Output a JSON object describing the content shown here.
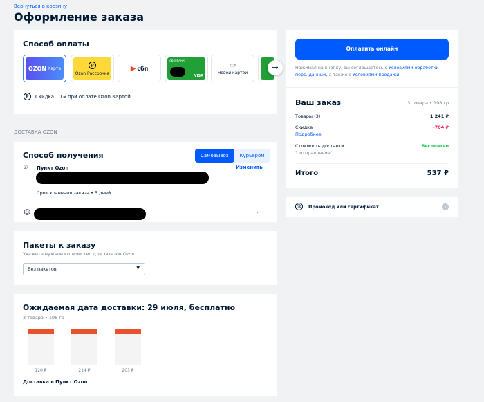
{
  "header": {
    "back_link": "Вернуться в корзину",
    "title": "Оформление заказа"
  },
  "payment": {
    "title": "Способ оплаты",
    "methods": [
      {
        "label": "OZON",
        "sub": "Карта"
      },
      {
        "label": "Ozon Рассрочка"
      },
      {
        "label": "сбп"
      },
      {
        "label": "СБЕРБАНК",
        "sub": "VISA"
      },
      {
        "label": "Новой картой"
      }
    ],
    "discount_note": "Скидка 10 ₽ при оплате Ozon Картой"
  },
  "delivery_section_label": "ДОСТАВКА OZON",
  "receipt": {
    "title": "Способ получения",
    "tabs": [
      "Самовывоз",
      "Курьером"
    ],
    "point": "Пункт Ozon",
    "change": "Изменить",
    "storage": "Срок хранения заказа • 5  дней"
  },
  "packages": {
    "title": "Пакеты к заказу",
    "hint": "Укажите нужное количество для заказов Ozon",
    "select_value": "Без пакетов"
  },
  "shipment": {
    "title": "Ожидаемая дата доставки: 29 июля, бесплатно",
    "meta": "3 товара • 198 гр",
    "prices": [
      "120 ₽",
      "214 ₽",
      "203 ₽"
    ],
    "footer": "Доставка в Пункт Ozon"
  },
  "summary": {
    "pay_button": "Оплатить онлайн",
    "agree_prefix": "Нажимая на кнопку, вы соглашаетесь с ",
    "agree_link1": "Условиями обработки перс. данных",
    "agree_mid": ", а также с ",
    "agree_link2": "Условиями продажи",
    "order_title": "Ваш заказ",
    "order_meta": "3 товара • 198 гр",
    "goods_label": "Товары (3)",
    "goods_value": "1 241 ₽",
    "discount_label": "Скидка",
    "discount_value": "-704 ₽",
    "details_link": "Подробнее",
    "delivery_label": "Стоимость доставки",
    "delivery_value": "Бесплатно",
    "shipments": "1 отправление",
    "total_label": "Итого",
    "total_value": "537 ₽"
  },
  "promo": {
    "label": "Промокод или сертификат"
  }
}
